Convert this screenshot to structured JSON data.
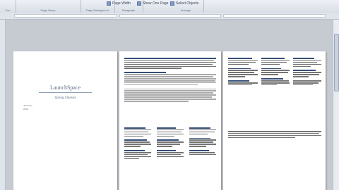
{
  "ribbon": {
    "groups": [
      {
        "label": "Fon"
      },
      {
        "label": "Page Setup"
      },
      {
        "label": "Page Background"
      },
      {
        "label": "Paragraph"
      },
      {
        "label": "Arrange"
      }
    ],
    "buttons": [
      {
        "label": "Page Width"
      },
      {
        "label": "Show One Page"
      },
      {
        "label": "Select Objects"
      }
    ]
  },
  "document": {
    "title": "LaunchSpace",
    "subtitle": "Spring Classes",
    "meta_lines": [
      "Jane Doe",
      "2010"
    ]
  }
}
